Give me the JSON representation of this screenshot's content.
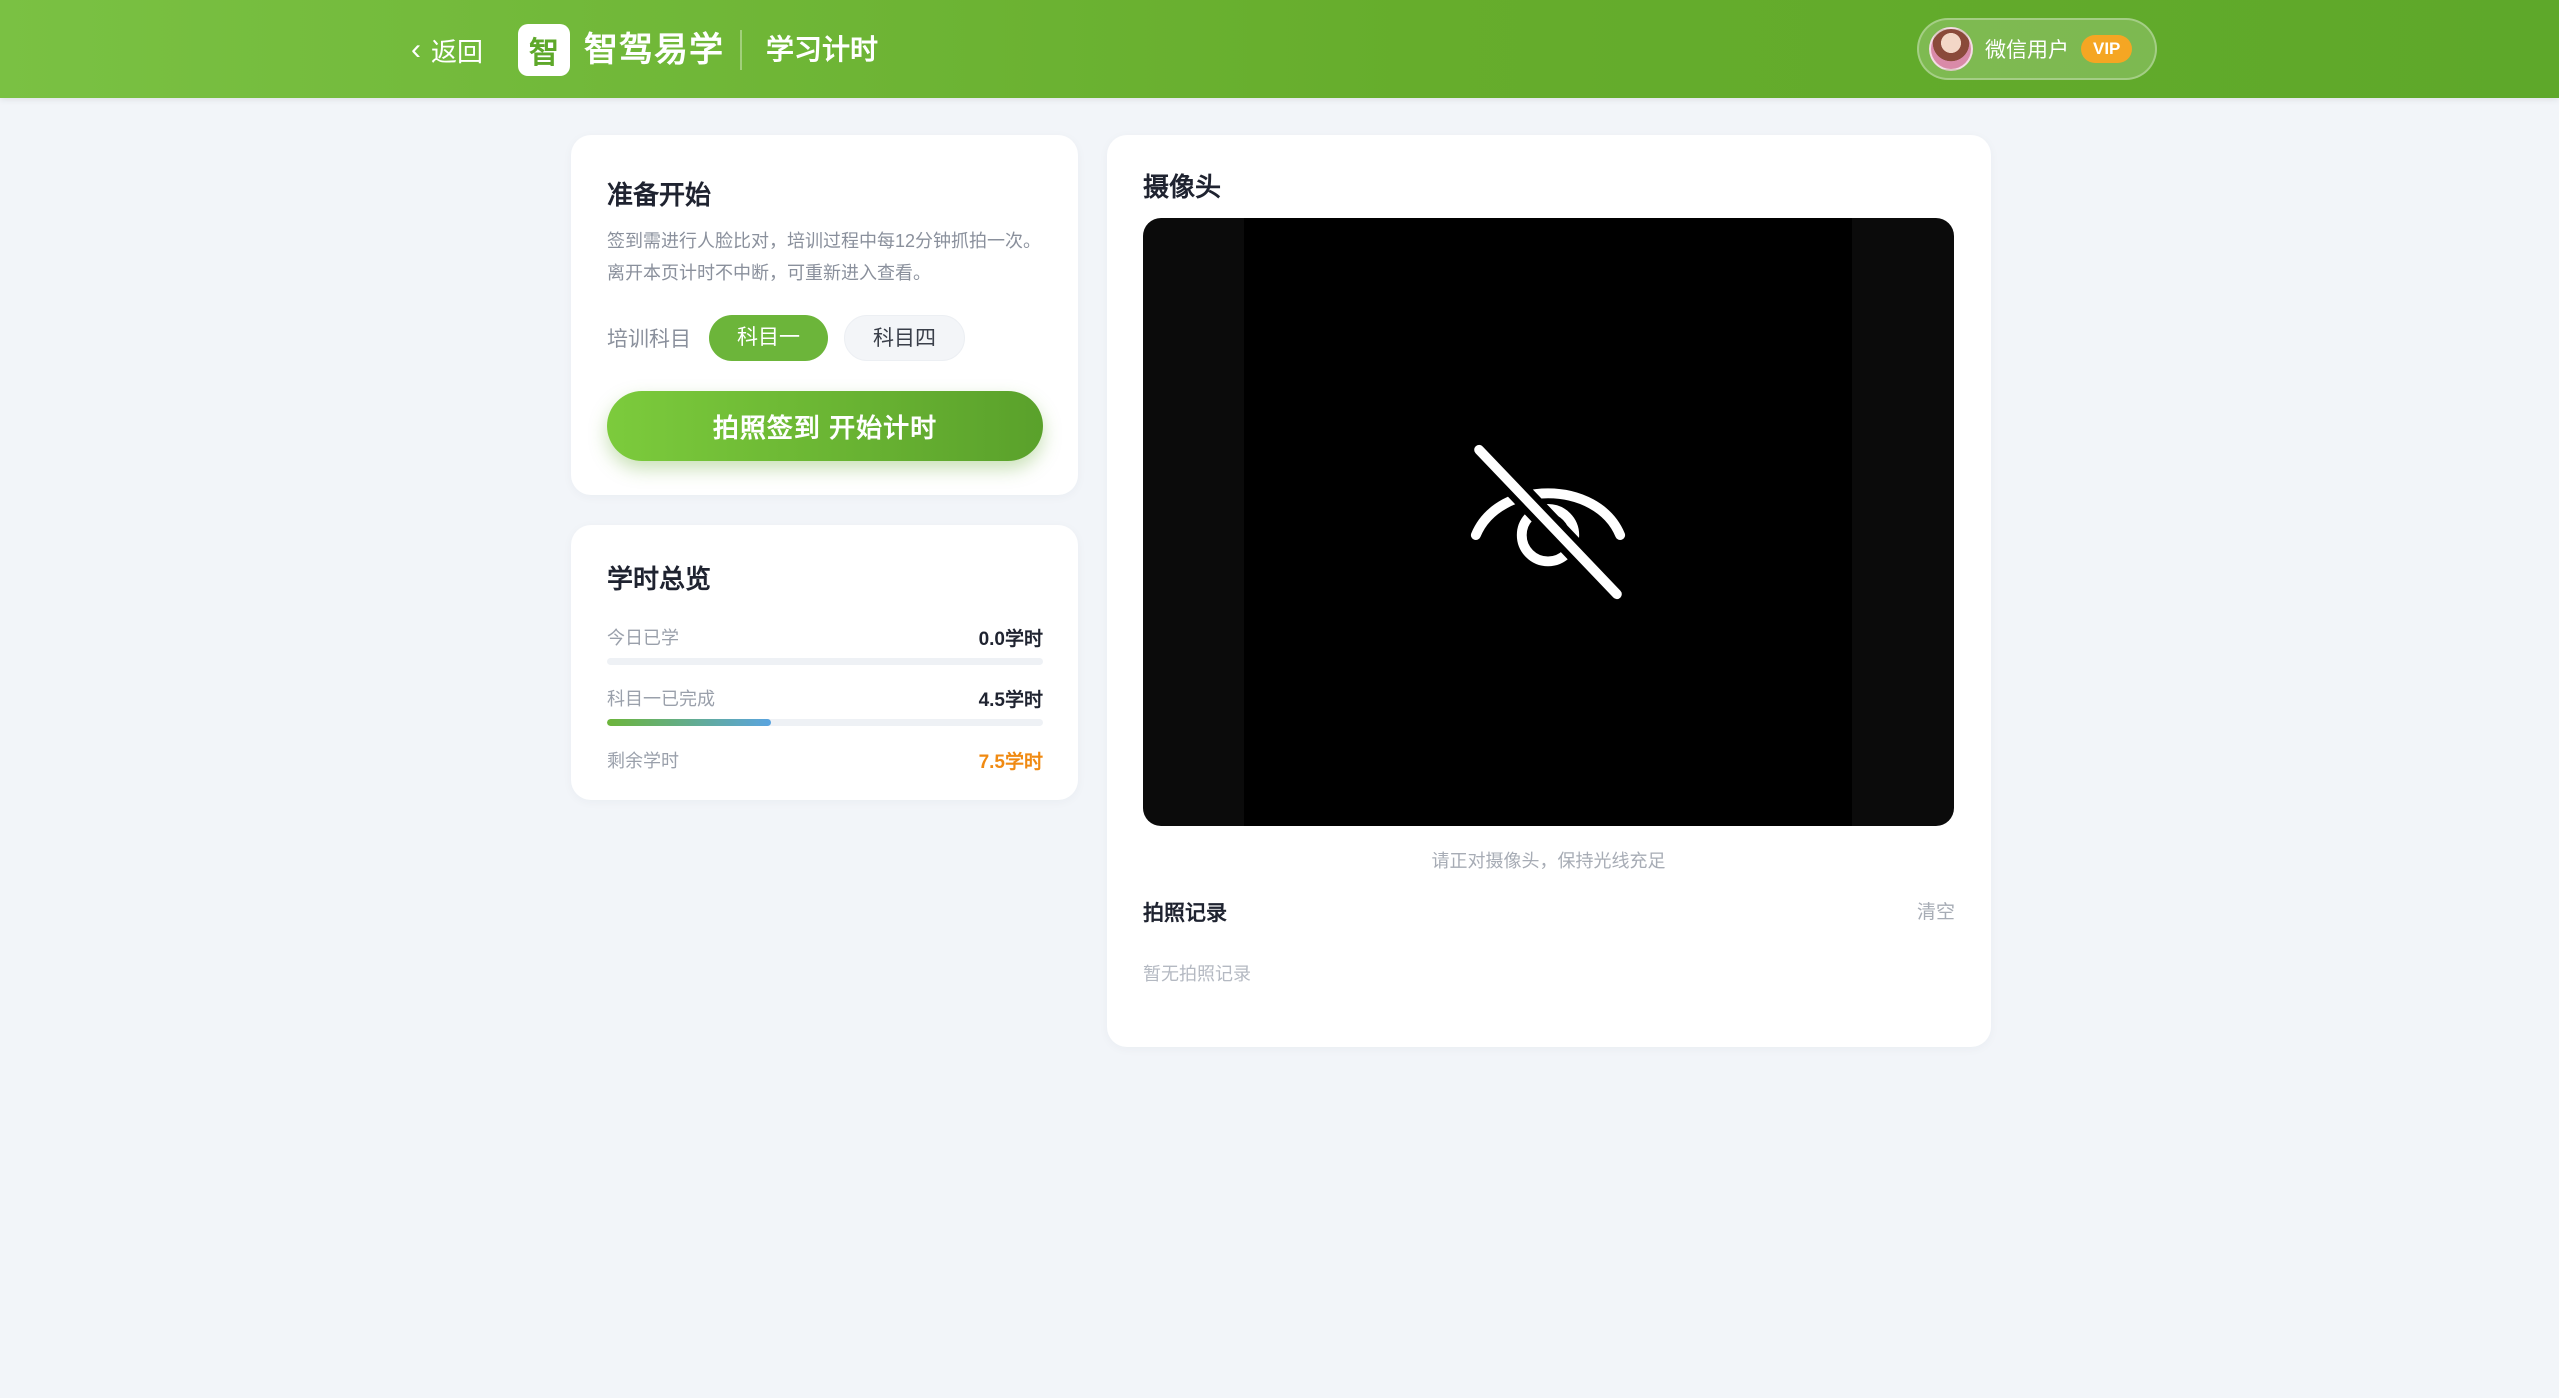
{
  "header": {
    "back_label": "返回",
    "back_icon": "chevron-left-icon",
    "logo_char": "智",
    "brand": "智驾易学",
    "page_title": "学习计时",
    "user_name": "微信用户",
    "vip_badge": "VIP",
    "accent_color": "#66ad2c"
  },
  "prep": {
    "title": "准备开始",
    "desc_line1": "签到需进行人脸比对，培训过程中每12分钟抓拍一次。",
    "desc_line2": "离开本页计时不中断，可重新进入查看。",
    "subject_label": "培训科目",
    "subjects": [
      {
        "label": "科目一",
        "active": true
      },
      {
        "label": "科目四",
        "active": false
      }
    ],
    "start_button": "拍照签到 开始计时"
  },
  "summary": {
    "title": "学时总览",
    "today_label": "今日已学",
    "today_value": "0.0学时",
    "today_progress": 0,
    "completed_label": "科目一已完成",
    "completed_value": "4.5学时",
    "completed_progress": 0.375,
    "remaining_label": "剩余学时",
    "remaining_value": "7.5学时",
    "remaining_color": "#f08a12"
  },
  "camera": {
    "title": "摄像头",
    "camera_icon": "eye-off-icon",
    "hint": "请正对摄像头，保持光线充足",
    "records_title": "拍照记录",
    "clear_label": "清空",
    "empty_text": "暂无拍照记录"
  }
}
